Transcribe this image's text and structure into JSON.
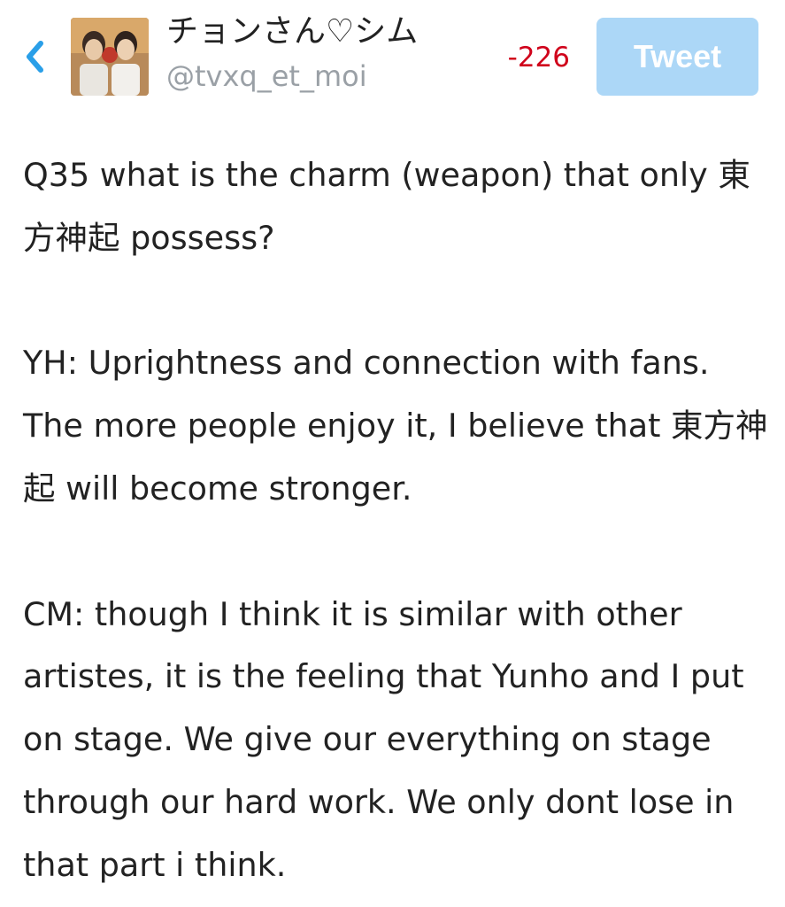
{
  "header": {
    "display_name": "チョンさん♡シム",
    "handle": "@tvxq_et_moi",
    "char_count": "-226",
    "tweet_label": "Tweet",
    "back_icon": "chevron-left-icon"
  },
  "colors": {
    "accent": "#2a9fe8",
    "tweet_button_disabled": "#acd7f7",
    "counter_negative": "#d0021b",
    "handle": "#9aa0a6",
    "text": "#222222"
  },
  "compose": {
    "paragraphs": [
      "Q35 what is the charm (weapon) that only 東方神起 possess?",
      "YH: Uprightness and connection with fans. The more people enjoy it, I believe that 東方神起 will become stronger.",
      "CM: though I think it is similar with other artistes, it is the feeling that Yunho and I put on stage. We give our everything on stage through our hard work. We only dont lose in that part i think."
    ]
  }
}
